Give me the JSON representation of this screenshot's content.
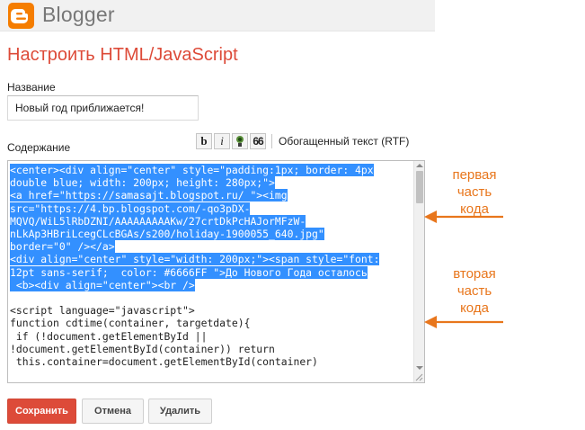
{
  "header": {
    "logo_text": "Blogger"
  },
  "page": {
    "title": "Настроить HTML/JavaScript"
  },
  "form": {
    "name_label": "Название",
    "name_value": "Новый год приближается!",
    "content_label": "Содержание"
  },
  "toolbar": {
    "bold_label": "b",
    "italic_label": "i",
    "quote_label": "66",
    "rtf_label": "Обогащенный текст (RTF)"
  },
  "editor": {
    "lines": [
      {
        "text": "<center><div align=\"center\" style=\"padding:1px; border: 4px",
        "selected": true
      },
      {
        "text": "double blue; width: 200px; height: 280px;\">",
        "selected": true
      },
      {
        "text": "<a href=\"https://samasajt.blogspot.ru/ \"><img",
        "selected": true
      },
      {
        "text": "src=\"https://4.bp.blogspot.com/-qo3pDX-",
        "selected": true
      },
      {
        "text": "MQVQ/WiL5lRbDZNI/AAAAAAAAAKw/27crtDkPcHAJorMFzW-",
        "selected": true
      },
      {
        "text": "nLkAp3HBriLcegCLcBGAs/s200/holiday-1900055_640.jpg\"",
        "selected": true
      },
      {
        "text": "border=\"0\" /></a>",
        "selected": true
      },
      {
        "text": "<div align=\"center\" style=\"width: 200px;\"><span style=\"font:",
        "selected": true
      },
      {
        "text": "12pt sans-serif;  color: #6666FF \">До Нового Года осталось",
        "selected": true
      },
      {
        "text": " <b><div align=\"center\"><br />",
        "selected": true
      },
      {
        "text": "",
        "selected": false
      },
      {
        "text": "<script language=\"javascript\">",
        "selected": false
      },
      {
        "text": "function cdtime(container, targetdate){",
        "selected": false
      },
      {
        "text": " if (!document.getElementById ||",
        "selected": false
      },
      {
        "text": "!document.getElementById(container)) return",
        "selected": false
      },
      {
        "text": " this.container=document.getElementById(container)",
        "selected": false
      }
    ]
  },
  "annotations": {
    "first": [
      "первая",
      "часть",
      "кода"
    ],
    "second": [
      "вторая",
      "часть",
      "кода"
    ]
  },
  "buttons": {
    "save": "Сохранить",
    "cancel": "Отмена",
    "delete": "Удалить"
  },
  "colors": {
    "accent": "#dd4b39",
    "annotation": "#e8761c",
    "selection": "#3390ff",
    "logo": "#f57d00"
  }
}
